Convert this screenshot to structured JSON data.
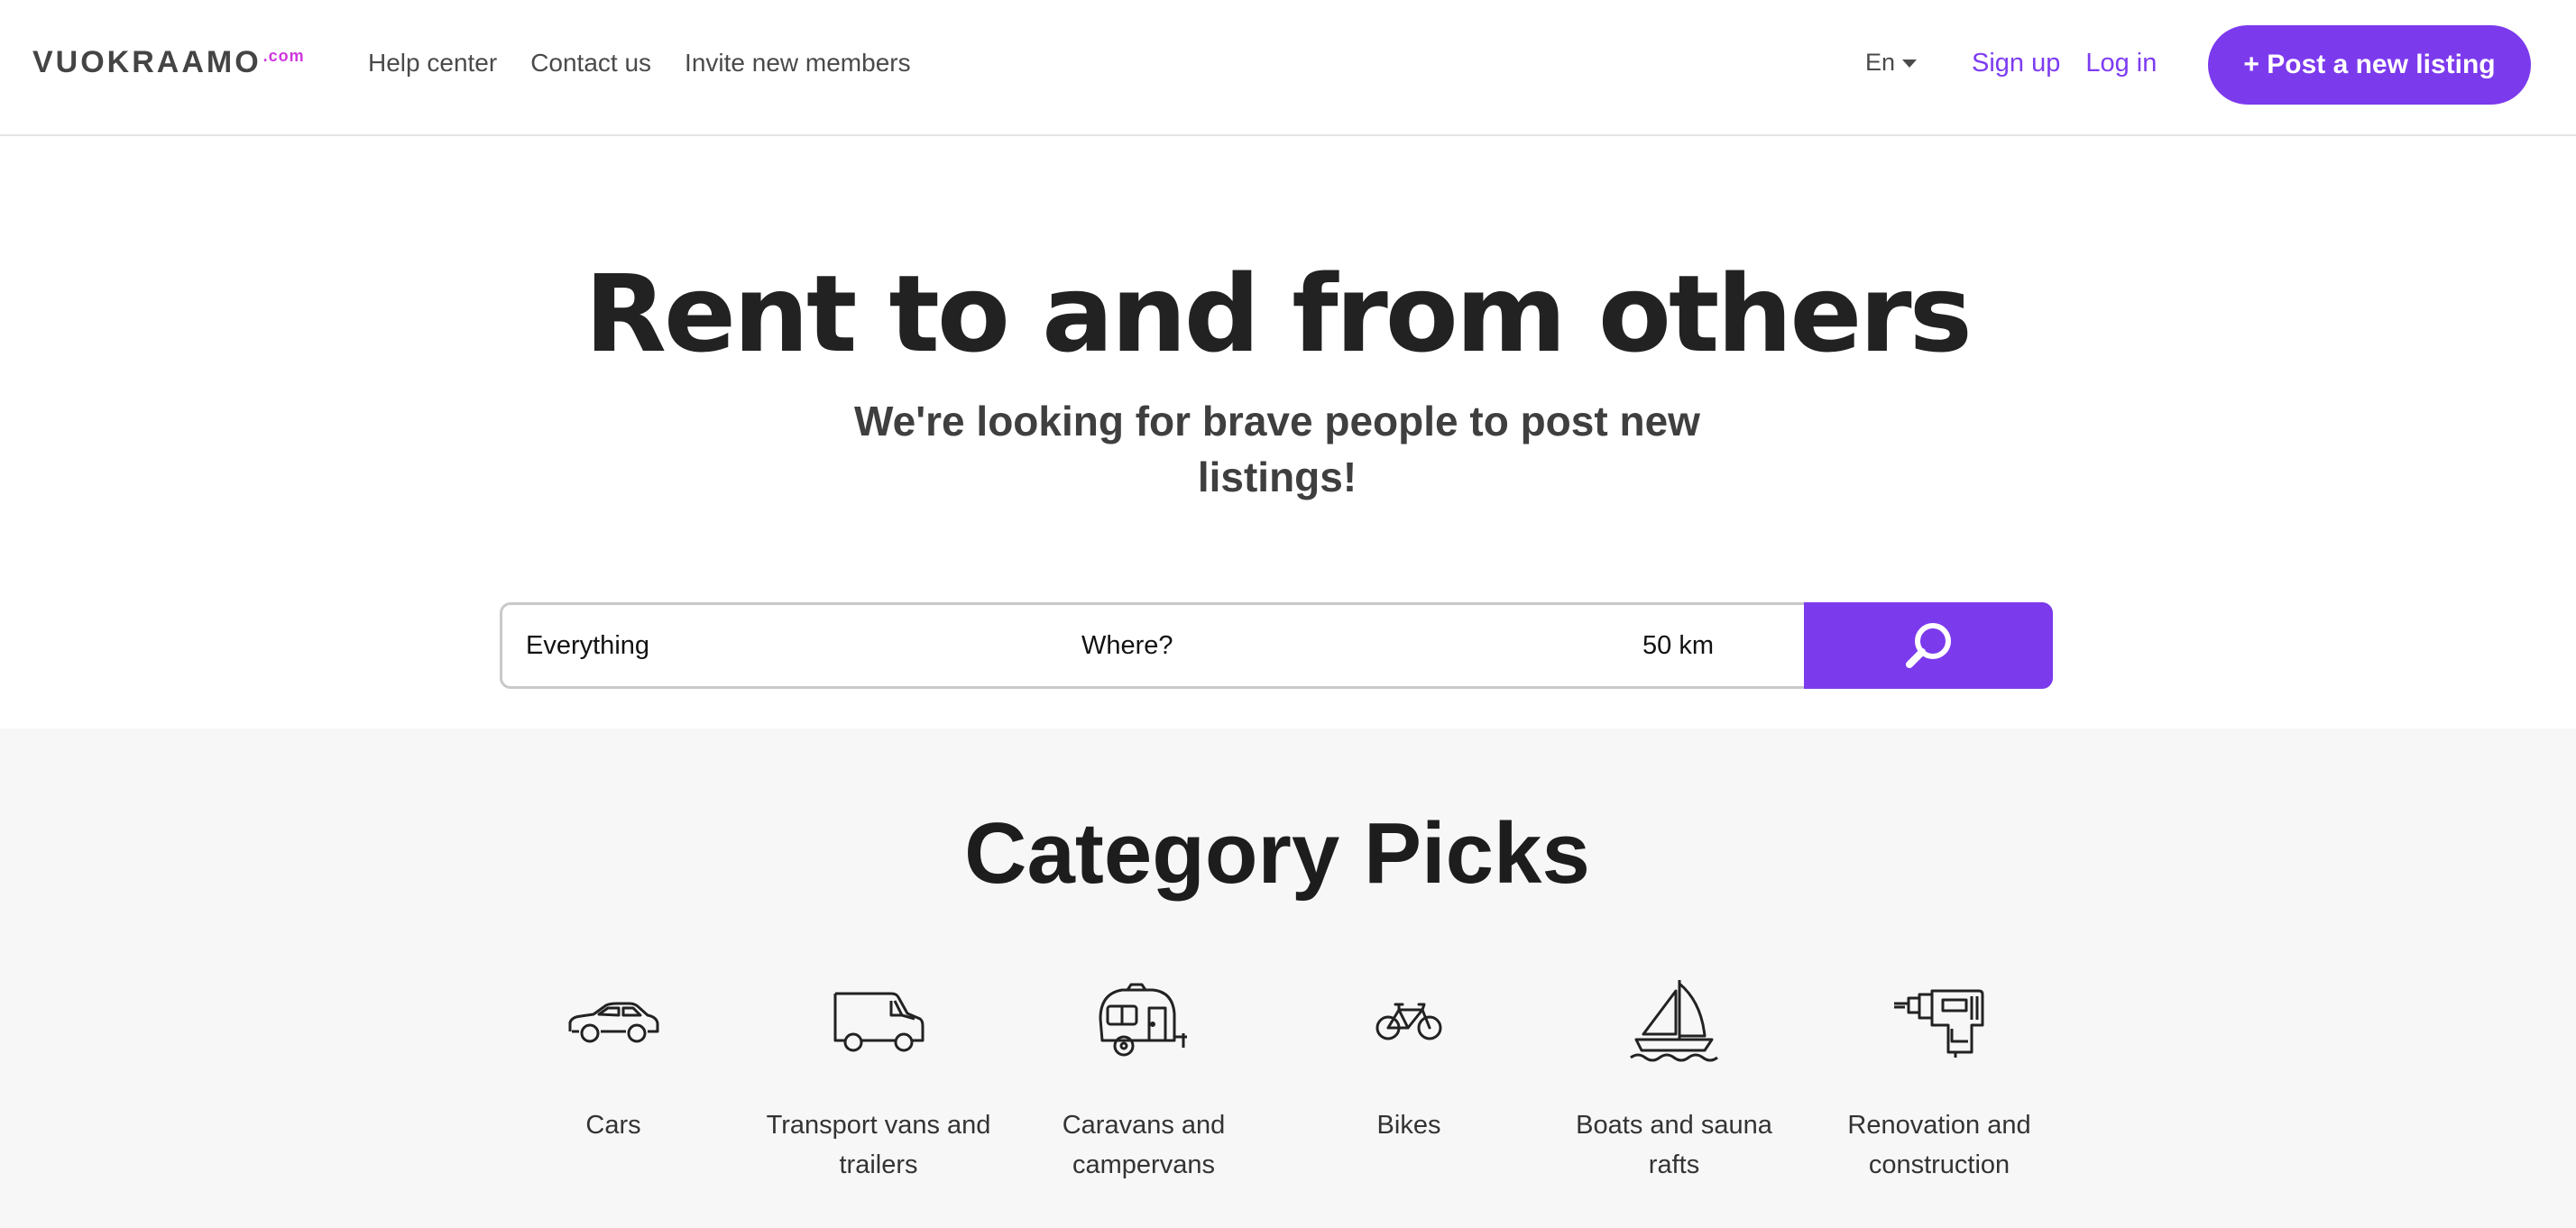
{
  "header": {
    "logo_text": "VUOKRAAMO",
    "logo_suffix": ".com",
    "nav": [
      {
        "label": "Help center"
      },
      {
        "label": "Contact us"
      },
      {
        "label": "Invite new members"
      }
    ],
    "language": "En",
    "signup_label": "Sign up",
    "login_label": "Log in",
    "post_button_label": "+ Post a new listing"
  },
  "hero": {
    "title": "Rent to and from others",
    "subtitle": "We're looking for brave people to post new listings!"
  },
  "search": {
    "what_value": "Everything",
    "where_placeholder": "Where?",
    "distance_value": "50 km",
    "button_icon": "search-icon"
  },
  "categories": {
    "title": "Category Picks",
    "items": [
      {
        "label": "Cars",
        "icon": "car-icon"
      },
      {
        "label": "Transport vans and trailers",
        "icon": "van-icon"
      },
      {
        "label": "Caravans and campervans",
        "icon": "caravan-icon"
      },
      {
        "label": "Bikes",
        "icon": "bicycle-icon"
      },
      {
        "label": "Boats and sauna rafts",
        "icon": "sailboat-icon"
      },
      {
        "label": "Renovation and construction",
        "icon": "drill-icon"
      }
    ]
  },
  "colors": {
    "accent": "#7c3aed",
    "link": "#7d3cf2",
    "logo_suffix": "#d036e0",
    "section_bg": "#f7f7f7"
  }
}
